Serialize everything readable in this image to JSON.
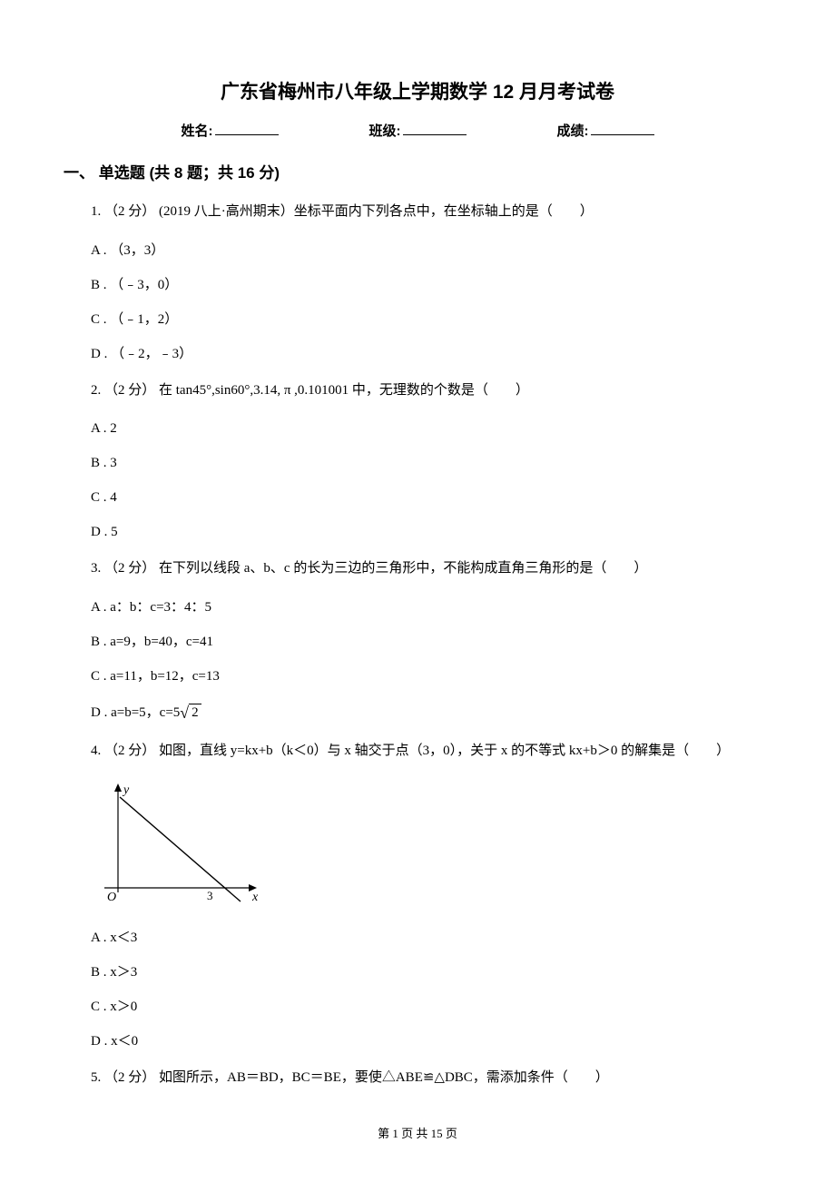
{
  "title": "广东省梅州市八年级上学期数学 12 月月考试卷",
  "info": {
    "name_label": "姓名:",
    "class_label": "班级:",
    "score_label": "成绩:"
  },
  "section1": {
    "heading": "一、 单选题 (共 8 题；共 16 分)"
  },
  "q1": {
    "stem": "1. （2 分） (2019 八上·高州期末）坐标平面内下列各点中，在坐标轴上的是（　　）",
    "a": "A . （3，3）",
    "b": "B . （﹣3，0）",
    "c": "C . （﹣1，2）",
    "d": "D . （﹣2，﹣3）"
  },
  "q2": {
    "stem": "2. （2 分） 在 tan45°,sin60°,3.14, π ,0.101001 中，无理数的个数是（　　）",
    "a": "A . 2",
    "b": "B . 3",
    "c": "C . 4",
    "d": "D . 5"
  },
  "q3": {
    "stem": "3. （2 分） 在下列以线段 a、b、c 的长为三边的三角形中，不能构成直角三角形的是（　　）",
    "a": "A . a：b：c=3：4：5",
    "b": "B . a=9，b=40，c=41",
    "c": "C . a=11，b=12，c=13",
    "d_prefix": "D . a=b=5，c=5",
    "d_sqrt": "2"
  },
  "q4": {
    "stem": "4. （2 分） 如图，直线 y=kx+b（k＜0）与 x 轴交于点（3，0），关于 x 的不等式 kx+b＞0 的解集是（　　）",
    "a": "A . x＜3",
    "b": "B . x＞3",
    "c": "C . x＞0",
    "d": "D . x＜0",
    "axis_y": "y",
    "axis_x": "x",
    "origin": "O",
    "xtick": "3"
  },
  "q5": {
    "stem": "5. （2 分） 如图所示，AB＝BD，BC＝BE，要使△ABE≌△DBC，需添加条件（　　）"
  },
  "footer": {
    "text": "第 1 页 共 15 页"
  }
}
